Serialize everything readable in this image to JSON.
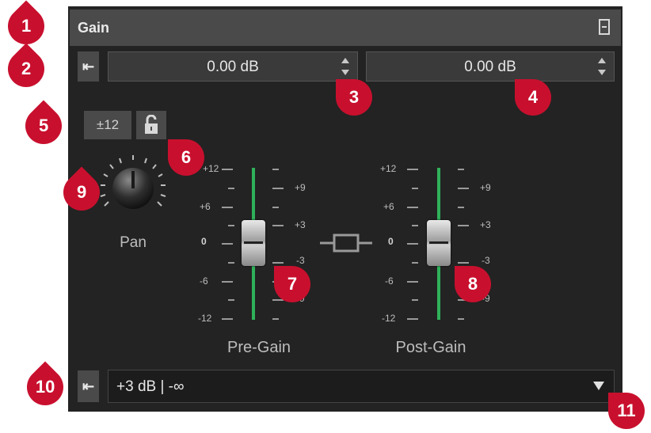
{
  "section": {
    "title": "Gain"
  },
  "gain_fields": {
    "pre_value": "0.00 dB",
    "post_value": "0.00 dB"
  },
  "range_button": {
    "label": "±12"
  },
  "pan": {
    "label": "Pan"
  },
  "faders": {
    "pre": {
      "label": "Pre-Gain",
      "left_ticks": [
        "+12",
        "+6",
        "0",
        "-6",
        "-12"
      ],
      "right_ticks": [
        "+9",
        "+3",
        "-3",
        "-9"
      ]
    },
    "post": {
      "label": "Post-Gain",
      "left_ticks": [
        "+12",
        "+6",
        "0",
        "-6",
        "-12"
      ],
      "right_ticks": [
        "+9",
        "+3",
        "-3",
        "-9"
      ]
    }
  },
  "preset_dropdown": {
    "value": "+3 dB | -∞"
  },
  "callouts": [
    "1",
    "2",
    "3",
    "4",
    "5",
    "6",
    "7",
    "8",
    "9",
    "10",
    "11"
  ],
  "colors": {
    "panel": "#232323",
    "header": "#4a4a4a",
    "fader_track": "#2fb15a",
    "callout": "#c8102e"
  }
}
